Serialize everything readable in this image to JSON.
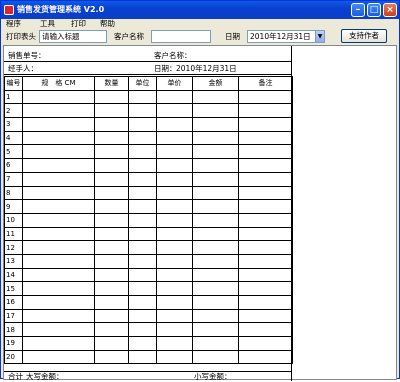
{
  "window": {
    "title": "销售发货管理系统  V2.0"
  },
  "menu": [
    "程序",
    "工具",
    "打印",
    "帮助"
  ],
  "toolbar": {
    "print_header_label": "打印表头",
    "print_header_value": "请输入标题",
    "customer_label": "客户名称",
    "customer_value": "",
    "date_label": "日期",
    "date_value": "2010年12月31日",
    "support_button": "支持作者"
  },
  "sheet": {
    "order_no_label": "销售单号：",
    "customer_label": "客户名称：",
    "handler_label": "经手人：",
    "date_label": "日期：",
    "date_value": "2010年12月31日",
    "columns": [
      "编号",
      "规　格 CM",
      "数量",
      "单位",
      "单价",
      "金额",
      "备注"
    ],
    "rows": [
      "1",
      "2",
      "3",
      "4",
      "5",
      "6",
      "7",
      "8",
      "9",
      "10",
      "11",
      "12",
      "13",
      "14",
      "15",
      "16",
      "17",
      "18",
      "19",
      "20"
    ],
    "total_label": "合计",
    "upper_amount_label": "大写金额：",
    "lower_amount_label": "小写金额："
  },
  "colors": {
    "titlebar": "#0a3fc6",
    "window_bg": "#ece9d8"
  }
}
